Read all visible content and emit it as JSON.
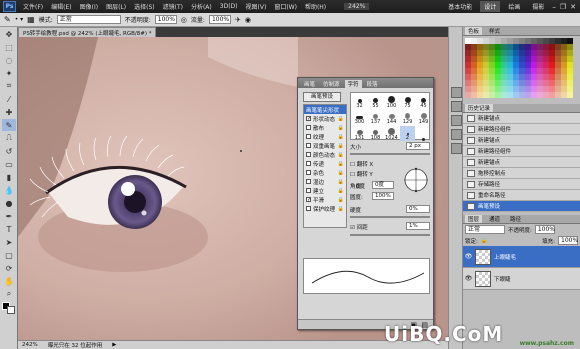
{
  "app": {
    "logo": "Ps",
    "zoom_display": "242%"
  },
  "menu": [
    "文件(F)",
    "编辑(E)",
    "图像(I)",
    "图层(L)",
    "选择(S)",
    "滤镜(T)",
    "分析(A)",
    "3D(D)",
    "视图(V)",
    "窗口(W)",
    "帮助(H)"
  ],
  "workspace": {
    "items": [
      "基本功能",
      "设计",
      "绘画",
      "摄影"
    ],
    "active": "设计"
  },
  "options_bar": {
    "mode_label": "模式:",
    "mode_value": "正常",
    "opacity_label": "不透明度:",
    "opacity_value": "100%",
    "flow_label": "流量:",
    "flow_value": "100%"
  },
  "document_tab": "PS转手绘教程.psd @ 242% (上眼睫毛, RGB/8#) *",
  "status": {
    "zoom": "242%",
    "info": "曝光只在 32 位起作用"
  },
  "swatches_panel": {
    "tabs": [
      "色板",
      "样式"
    ],
    "active": "色板"
  },
  "history_panel": {
    "tabs": [
      "历史记录"
    ],
    "items": [
      "新建锚点",
      "新建路径组件",
      "新建锚点",
      "新建路径组件",
      "新建锚点",
      "拖移控制点",
      "存储路径",
      "重命名路径",
      "画笔预设"
    ],
    "active_index": 8
  },
  "layers_panel": {
    "tabs": [
      "图层",
      "通道",
      "路径"
    ],
    "blend_mode": "正常",
    "opacity_label": "不透明度:",
    "opacity_value": "100%",
    "lock_label": "锁定:",
    "fill_label": "填充:",
    "fill_value": "100%",
    "layers": [
      {
        "name": "上眼睫毛",
        "active": true
      },
      {
        "name": "下眼睫",
        "active": false
      }
    ]
  },
  "brush_panel": {
    "tabs": [
      "画笔",
      "仿制源",
      "字符",
      "段落"
    ],
    "active_tab": "画笔",
    "preset_button": "画笔预设",
    "options": [
      {
        "label": "画笔笔尖形状",
        "checked": false,
        "selected": true
      },
      {
        "label": "形状动态",
        "checked": true
      },
      {
        "label": "散布",
        "checked": false
      },
      {
        "label": "纹理",
        "checked": false
      },
      {
        "label": "双重画笔",
        "checked": false
      },
      {
        "label": "颜色动态",
        "checked": false
      },
      {
        "label": "传递",
        "checked": false
      },
      {
        "label": "杂色",
        "checked": false
      },
      {
        "label": "湿边",
        "checked": false
      },
      {
        "label": "建立",
        "checked": false
      },
      {
        "label": "平滑",
        "checked": true
      },
      {
        "label": "保护纹理",
        "checked": false
      }
    ],
    "tips": [
      "32",
      "55",
      "100",
      "75",
      "45",
      "300",
      "137",
      "144",
      "129",
      "149",
      "131",
      "108",
      "1024",
      "2",
      ""
    ],
    "selected_tip_index": 13,
    "size_label": "大小",
    "size_value": "2 px",
    "flip_x": "翻转 X",
    "flip_y": "翻转 Y",
    "angle_label": "角度:",
    "angle_value": "0度",
    "roundness_label": "圆度:",
    "roundness_value": "100%",
    "hardness_label": "硬度",
    "hardness_value": "0%",
    "spacing_label": "间距",
    "spacing_value": "1%"
  },
  "watermark": {
    "main": "UiBQ.CoM",
    "sub": "www.psahz.com"
  },
  "colors": {
    "accent": "#3a6ec5",
    "iris": "#5a4a78"
  }
}
